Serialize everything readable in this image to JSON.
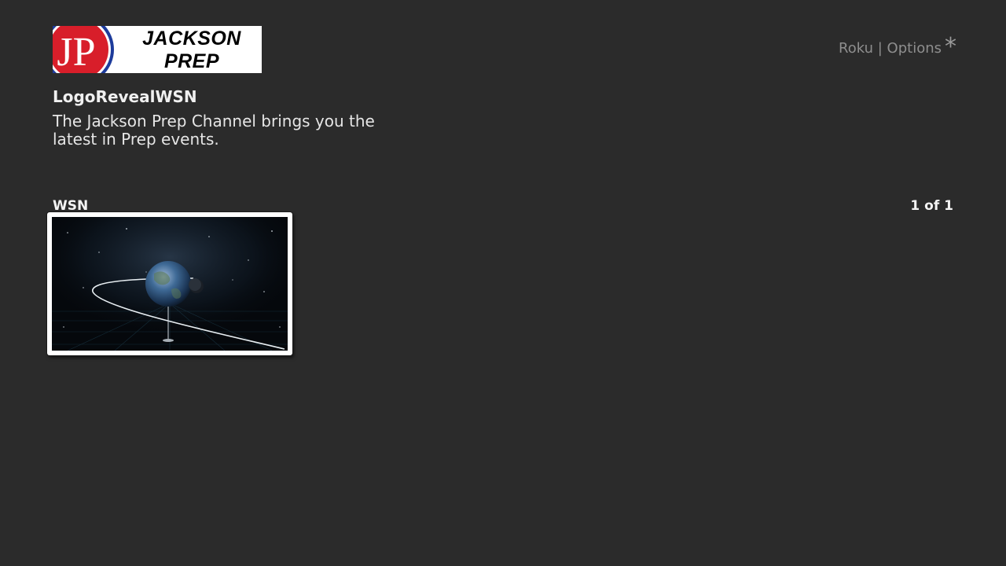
{
  "header": {
    "logo": {
      "monogram": "JP",
      "line1": "JACKSON",
      "line2": "PREP",
      "colors": {
        "red": "#d81e2a",
        "blue": "#1d3b9b",
        "background": "#ffffff"
      }
    },
    "options_hint": {
      "label": "Roku | Options",
      "glyph": "*",
      "icon": "asterisk-icon"
    }
  },
  "selected_item": {
    "title": "LogoRevealWSN",
    "description": "The Jackson Prep Channel brings you the latest in Prep events."
  },
  "row": {
    "label": "WSN",
    "counter": "1 of 1",
    "tiles": [
      {
        "thumbnail": "earth-orbit-thumbnail",
        "focused": true
      }
    ]
  },
  "theme": {
    "background": "#2b2b2b",
    "text": "#ececec",
    "muted": "#8e8e8e",
    "focus_border": "#ffffff"
  }
}
